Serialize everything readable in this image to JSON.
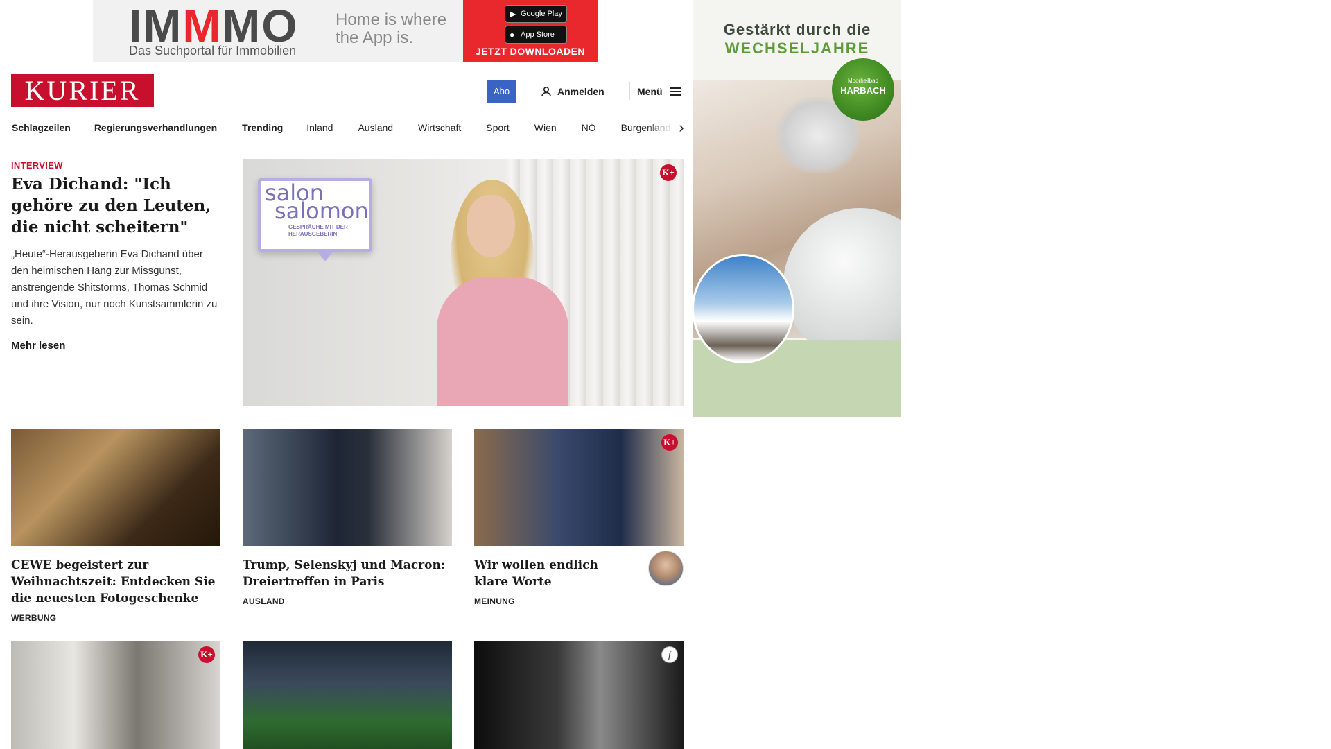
{
  "top_ad": {
    "brand_part1": "IM",
    "brand_part2": "M",
    "brand_part3": "MO",
    "subline": "Das Suchportal für Immobilien",
    "tagline": "Home is where the App is.",
    "google_play_label": "Google Play",
    "app_store_label": "App Store",
    "cta": "JETZT DOWNLOADEN"
  },
  "header": {
    "logo_text": "KURIER",
    "abo_label": "Abo",
    "login_label": "Anmelden",
    "menu_label": "Menü",
    "brand_color": "#c8102e",
    "accent_color": "#3a63c6"
  },
  "nav": {
    "items": [
      "Schlagzeilen",
      "Regierungsverhandlungen",
      "Trending",
      "Inland",
      "Ausland",
      "Wirtschaft",
      "Sport",
      "Wien",
      "NÖ",
      "Burgenland"
    ],
    "scroll_icon": "chevron-right-icon"
  },
  "hero": {
    "kicker": "INTERVIEW",
    "title": "Eva Dichand: \"Ich gehöre zu den Leuten, die nicht scheitern\"",
    "teaser": "„Heute“-Herausgeberin Eva Dichand über den heimischen Hang zur Missgunst, anstrengende Shitstorms, Thomas Schmid und ihre Vision, nur noch Kunstsammlerin zu sein.",
    "more_label": "Mehr lesen",
    "badge": "K+",
    "salon_line1": "salon",
    "salon_line2": "salomon",
    "salon_line3": "GESPRÄCHE MIT DER HERAUSGEBERIN"
  },
  "articles": [
    {
      "title": "CEWE begeistert zur Weihnachts­zeit: Entdecken Sie die neuesten Fotogeschenke",
      "category": "WERBUNG"
    },
    {
      "title": "Trump, Selenskyj und Macron: Dreiertreffen in Paris",
      "category": "AUSLAND"
    },
    {
      "title": "Wir wollen endlich klare Worte",
      "category": "MEINUNG",
      "badge": "K+"
    }
  ],
  "second_row_badges": {
    "left": "K+",
    "right": "f"
  },
  "side_ad": {
    "headline1": "Gestärkt durch die",
    "headline2": "WECHSELJAHRE",
    "badge_small": "Moorheilbad",
    "badge_big": "HARBACH"
  }
}
